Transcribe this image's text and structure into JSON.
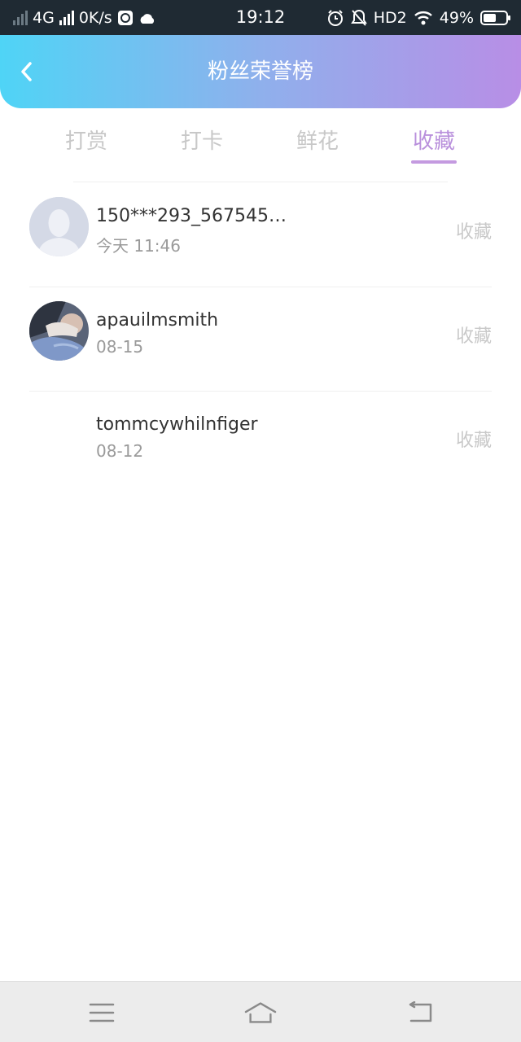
{
  "status_bar": {
    "network": "4G",
    "speed": "0K/s",
    "time": "19:12",
    "hd": "HD2",
    "battery": "49%"
  },
  "header": {
    "title": "粉丝荣誉榜",
    "back_icon": "chevron-left-icon"
  },
  "tabs": [
    {
      "label": "打赏",
      "active": false
    },
    {
      "label": "打卡",
      "active": false
    },
    {
      "label": "鲜花",
      "active": false
    },
    {
      "label": "收藏",
      "active": true
    }
  ],
  "list": [
    {
      "name": "150***293_567545…",
      "date": "今天 11:46",
      "action": "收藏",
      "avatar": "default-avatar"
    },
    {
      "name": "apauilmsmith",
      "date": "08-15",
      "action": "收藏",
      "avatar": "photo-avatar"
    },
    {
      "name": "tommcywhilnfiger",
      "date": "08-12",
      "action": "收藏",
      "avatar": "empty-avatar"
    }
  ],
  "colors": {
    "accent": "#b990dc",
    "gradient_start": "#4fd4f6",
    "gradient_end": "#b88ee6"
  }
}
